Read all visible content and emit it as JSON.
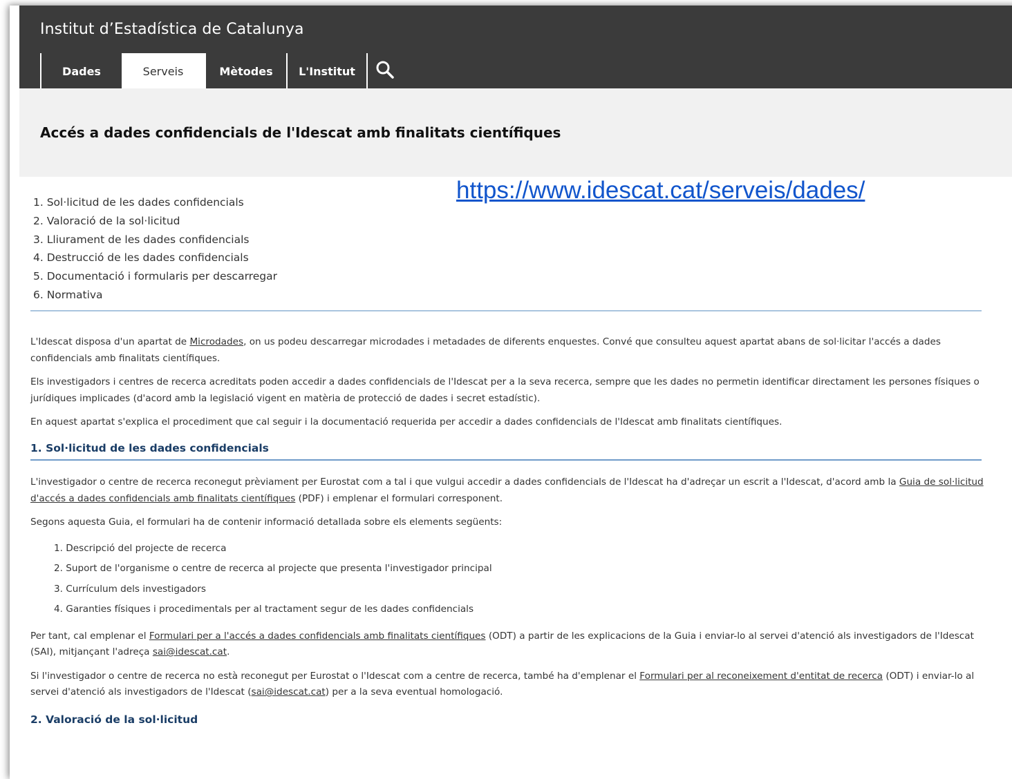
{
  "header": {
    "site_title": "Institut d’Estadística de Catalunya",
    "nav": [
      {
        "label": "Dades",
        "active": false
      },
      {
        "label": "Serveis",
        "active": true
      },
      {
        "label": "Mètodes",
        "active": false
      },
      {
        "label": "L'Institut",
        "active": false
      }
    ],
    "search_icon": "search-icon"
  },
  "page_title": "Accés a dades confidencials de l'Idescat amb finalitats científiques",
  "url_overlay": "https://www.idescat.cat/serveis/dades/",
  "toc": [
    "1. Sol·licitud de les dades confidencials",
    "2. Valoració de la sol·licitud",
    "3. Lliurament de les dades confidencials",
    "4. Destrucció de les dades confidencials",
    "5. Documentació i formularis per descarregar",
    "6. Normativa"
  ],
  "intro": {
    "p1_before": "L'Idescat disposa d'un apartat de ",
    "p1_link": "Microdades",
    "p1_after": ", on us podeu descarregar microdades i metadades de diferents enquestes. Convé que consulteu aquest apartat abans de sol·licitar l'accés a dades confidencials amb finalitats científiques.",
    "p2": "Els investigadors i centres de recerca acreditats poden accedir a dades confidencials de l'Idescat per a la seva recerca, sempre que les dades no permetin identificar directament les persones físiques o jurídiques implicades (d'acord amb la legislació vigent en matèria de protecció de dades i secret estadístic).",
    "p3": "En aquest apartat s'explica el procediment que cal seguir i la documentació requerida per accedir a dades confidencials de l'Idescat amb finalitats científiques."
  },
  "section1": {
    "heading": "1. Sol·licitud de les dades confidencials",
    "p1_before": "L'investigador o centre de recerca reconegut prèviament per Eurostat com a tal i que vulgui accedir a dades confidencials de l'Idescat ha d'adreçar un escrit a l'Idescat, d'acord amb la ",
    "p1_link": "Guia de sol·licitud d'accés a dades confidencials amb finalitats científiques",
    "p1_after": " (PDF) i emplenar el formulari corresponent.",
    "p2": "Segons aquesta Guia, el formulari ha de contenir informació detallada sobre els elements següents:",
    "items": [
      "1. Descripció del projecte de recerca",
      "2. Suport de l'organisme o centre de recerca al projecte que presenta l'investigador principal",
      "3. Currículum dels investigadors",
      "4. Garanties físiques i procedimentals per al tractament segur de les dades confidencials"
    ],
    "p3_before": "Per tant, cal emplenar el ",
    "p3_link": "Formulari per a l'accés a dades confidencials amb finalitats científiques",
    "p3_middle": " (ODT) a partir de les explicacions de la Guia i enviar-lo al servei d'atenció als investigadors de l'Idescat (SAI), mitjançant l'adreça ",
    "p3_email": "sai@idescat.cat",
    "p3_after": ".",
    "p4_before": "Si l'investigador o centre de recerca no està reconegut per Eurostat o l'Idescat com a centre de recerca, també ha d'emplenar el ",
    "p4_link": "Formulari per al reconeixement d'entitat de recerca",
    "p4_middle": " (ODT) i enviar-lo al servei d'atenció als investigadors de l'Idescat (",
    "p4_email": "sai@idescat.cat",
    "p4_after": ") per a la seva eventual homologació."
  },
  "section2": {
    "heading": "2. Valoració de la sol·licitud"
  }
}
